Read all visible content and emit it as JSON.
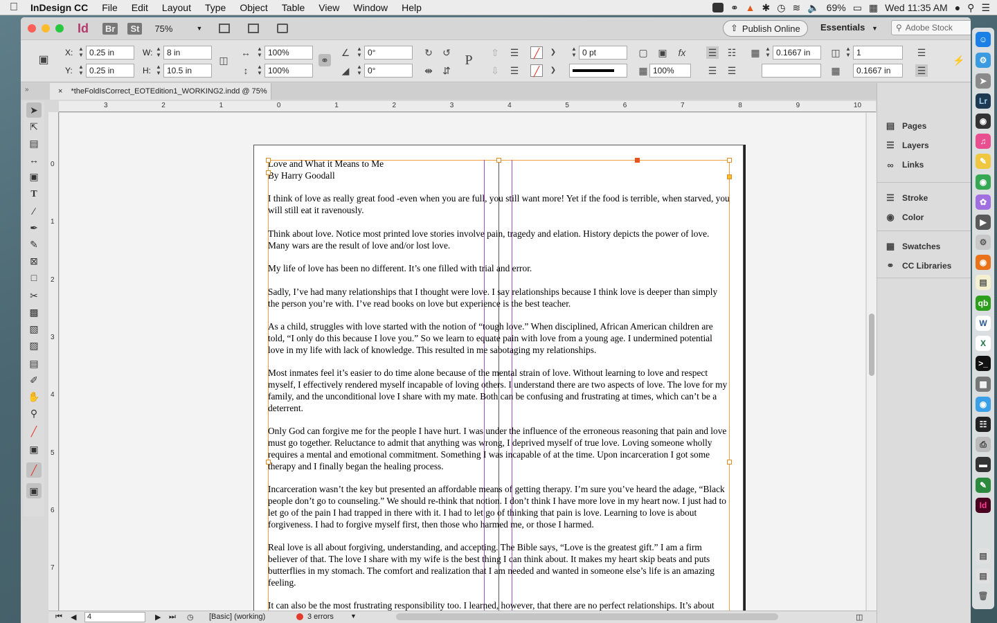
{
  "menubar": {
    "app_name": "InDesign CC",
    "items": [
      "File",
      "Edit",
      "Layout",
      "Type",
      "Object",
      "Table",
      "View",
      "Window",
      "Help"
    ],
    "battery": "69%",
    "clock": "Wed 11:35 AM"
  },
  "titlebar": {
    "badge_id": "Id",
    "badge_br": "Br",
    "badge_st": "St",
    "zoom": "75%",
    "publish": "Publish Online",
    "workspace": "Essentials",
    "stock_placeholder": "Adobe Stock"
  },
  "control": {
    "x_label": "X:",
    "x": "0.25 in",
    "y_label": "Y:",
    "y": "0.25 in",
    "w_label": "W:",
    "w": "8 in",
    "h_label": "H:",
    "h": "10.5 in",
    "scale_x": "100%",
    "scale_y": "100%",
    "rotate": "0°",
    "shear": "0°",
    "stroke_weight": "0 pt",
    "opacity": "100%",
    "gutter": "0.1667 in",
    "columns": "1",
    "column_width": "0.1667 in"
  },
  "tab": {
    "close": "×",
    "title": "*theFoldIsCorrect_EOTEdition1_WORKING2.indd @ 75%"
  },
  "ruler": {
    "h_labels": [
      "3",
      "2",
      "1",
      "0",
      "1",
      "2",
      "3",
      "4",
      "5",
      "6",
      "7",
      "8",
      "9",
      "10"
    ],
    "v_labels": [
      "0",
      "1",
      "2",
      "3",
      "4",
      "5",
      "6",
      "7"
    ]
  },
  "document": {
    "title": "Love and What it Means to Me",
    "byline": "By Harry Goodall",
    "paragraphs": [
      "I think of love as really great food -even when you are full, you still want more! Yet if the food is terrible, when starved, you will still eat it ravenously.",
      "Think about love. Notice most printed love stories involve pain, tragedy and elation. History depicts the power of love. Many wars are the result of love and/or lost love.",
      "My life of love has been no different. It’s one filled with trial and error.",
      "Sadly, I’ve had many relationships that I thought were love. I say relationships because I think love is deeper than simply the person you’re with. I’ve read books on love but experience is the best teacher.",
      "As a child, struggles with love started with the notion of “tough love.” When disciplined, African American children are told, “I only do this because I love you.” So we learn to equate pain with love from a young age. I undermined potential love in my life with lack of knowledge. This resulted in me sabotaging my relationships.",
      "Most inmates feel it’s easier to do time alone because of the mental strain of love. Without learning to love and respect myself, I effectively rendered myself incapable of loving others. I understand there are two aspects of love. The love for my family, and the unconditional love I share with my mate. Both can be confusing and frustrating at times, which can’t be a deterrent.",
      "Only God can forgive me for the people I have hurt. I was under the influence of the erroneous reasoning that pain and love must go together. Reluctance to admit that anything was wrong, I deprived myself of true love. Loving someone wholly requires a mental and emotional commitment. Something I was incapable of at the time. Upon incarceration I got some therapy and I finally began the healing process.",
      "Incarceration wasn’t the key but presented an affordable means of getting therapy. I’m sure you’ve heard the adage, “Black people don’t go to counseling.” We should re-think that notion. I don’t think I have more love in my heart now. I just had to let go of the pain I had trapped in there with it. I had to let go of thinking that pain is love. Learning to love is about forgiveness. I had to forgive myself first, then those who harmed me, or those I harmed.",
      "Real love is all about forgiving, understanding, and accepting. The Bible says, “Love is the greatest gift.” I am a firm believer of that. The love I share with my wife is the best thing I can think about. It makes my heart skip beats and puts butterflies in my stomach. The comfort and realization that I am needed and wanted in someone else’s life is an amazing feeling.",
      "It can also be the most frustrating responsibility too. I learned, however, that there are no perfect relationships. It’s about"
    ]
  },
  "statusbar": {
    "page": "4",
    "style": "[Basic] (working)",
    "errors": "3 errors"
  },
  "panels": {
    "group1": [
      "Pages",
      "Layers",
      "Links"
    ],
    "group2": [
      "Stroke",
      "Color"
    ],
    "group3": [
      "Swatches",
      "CC Libraries"
    ]
  },
  "dock": {
    "labels": [
      "Lr",
      "Id"
    ]
  },
  "colors": {
    "accent_red": "#e33b2e",
    "frame_orange": "#f0a040",
    "guide_purple": "#a050c0"
  }
}
